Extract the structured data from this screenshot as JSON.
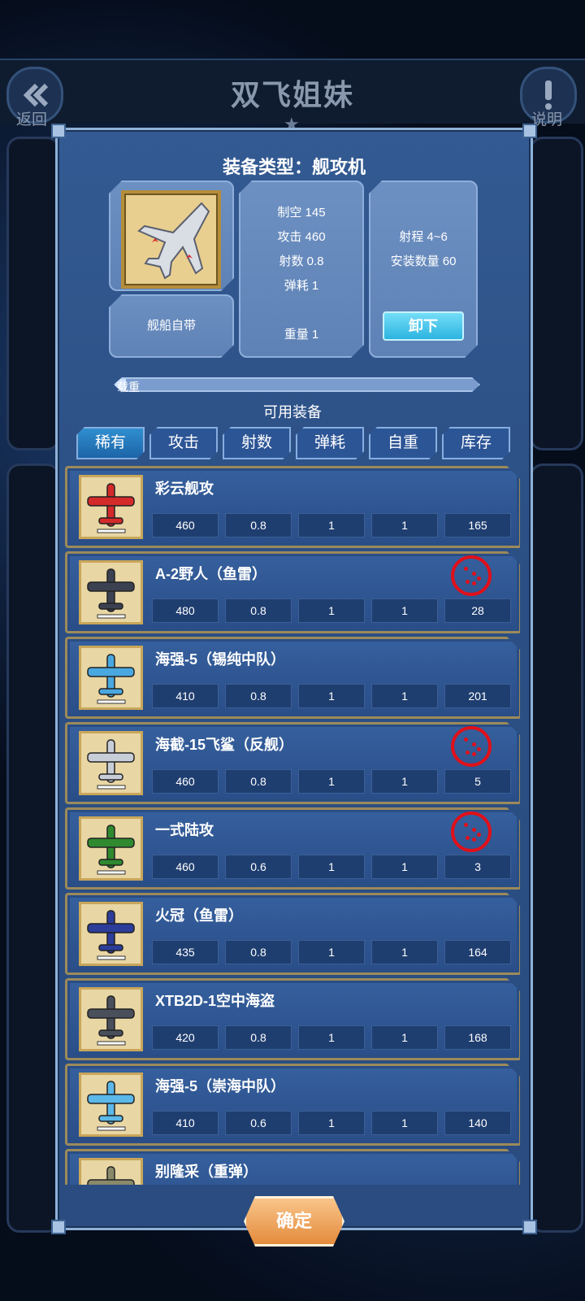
{
  "header": {
    "title": "双飞姐妹",
    "back_label": "返回",
    "help_label": "说明"
  },
  "modal": {
    "title": "装备类型：舰攻机",
    "current_item": {
      "source_label": "舰船自带",
      "stats_middle": [
        "制空 145",
        "攻击 460",
        "射数 0.8",
        "弹耗 1",
        "重量 1"
      ],
      "stats_right": [
        "射程 4~6",
        "安装数量 60"
      ],
      "unload_label": "卸下"
    },
    "load_label": "载重",
    "load_fraction": 0.03,
    "available_title": "可用装备",
    "tabs": [
      {
        "label": "稀有",
        "active": true
      },
      {
        "label": "攻击",
        "active": false
      },
      {
        "label": "射数",
        "active": false
      },
      {
        "label": "弹耗",
        "active": false
      },
      {
        "label": "自重",
        "active": false
      },
      {
        "label": "库存",
        "active": false
      }
    ],
    "items": [
      {
        "name": "彩云舰攻",
        "values": [
          "460",
          "0.8",
          "1",
          "1",
          "165"
        ],
        "stamp": false,
        "plane_color": "#d42a2a"
      },
      {
        "name": "A-2野人（鱼雷）",
        "values": [
          "480",
          "0.8",
          "1",
          "1",
          "28"
        ],
        "stamp": true,
        "plane_color": "#3b4150"
      },
      {
        "name": "海强-5（锡纯中队）",
        "values": [
          "410",
          "0.8",
          "1",
          "1",
          "201"
        ],
        "stamp": false,
        "plane_color": "#4aa8e0"
      },
      {
        "name": "海截-15飞鲨（反舰）",
        "values": [
          "460",
          "0.8",
          "1",
          "1",
          "5"
        ],
        "stamp": true,
        "plane_color": "#c8ced8"
      },
      {
        "name": "一式陆攻",
        "values": [
          "460",
          "0.6",
          "1",
          "1",
          "3"
        ],
        "stamp": true,
        "plane_color": "#2f8a2f"
      },
      {
        "name": "火冠（鱼雷）",
        "values": [
          "435",
          "0.8",
          "1",
          "1",
          "164"
        ],
        "stamp": false,
        "plane_color": "#2c3d9a"
      },
      {
        "name": "XTB2D-1空中海盗",
        "values": [
          "420",
          "0.8",
          "1",
          "1",
          "168"
        ],
        "stamp": false,
        "plane_color": "#4a4f5c"
      },
      {
        "name": "海强-5（崇海中队）",
        "values": [
          "410",
          "0.6",
          "1",
          "1",
          "140"
        ],
        "stamp": false,
        "plane_color": "#5cb8e8"
      },
      {
        "name": "别隆采（重弹）",
        "values": [
          "",
          "",
          "",
          "",
          ""
        ],
        "stamp": false,
        "plane_color": "#8a8a6a"
      }
    ],
    "confirm_label": "确定"
  },
  "colors": {
    "accent_blue": "#2cb4e0",
    "confirm_orange": "#e48b3c",
    "stamp_red": "#e0101a"
  }
}
